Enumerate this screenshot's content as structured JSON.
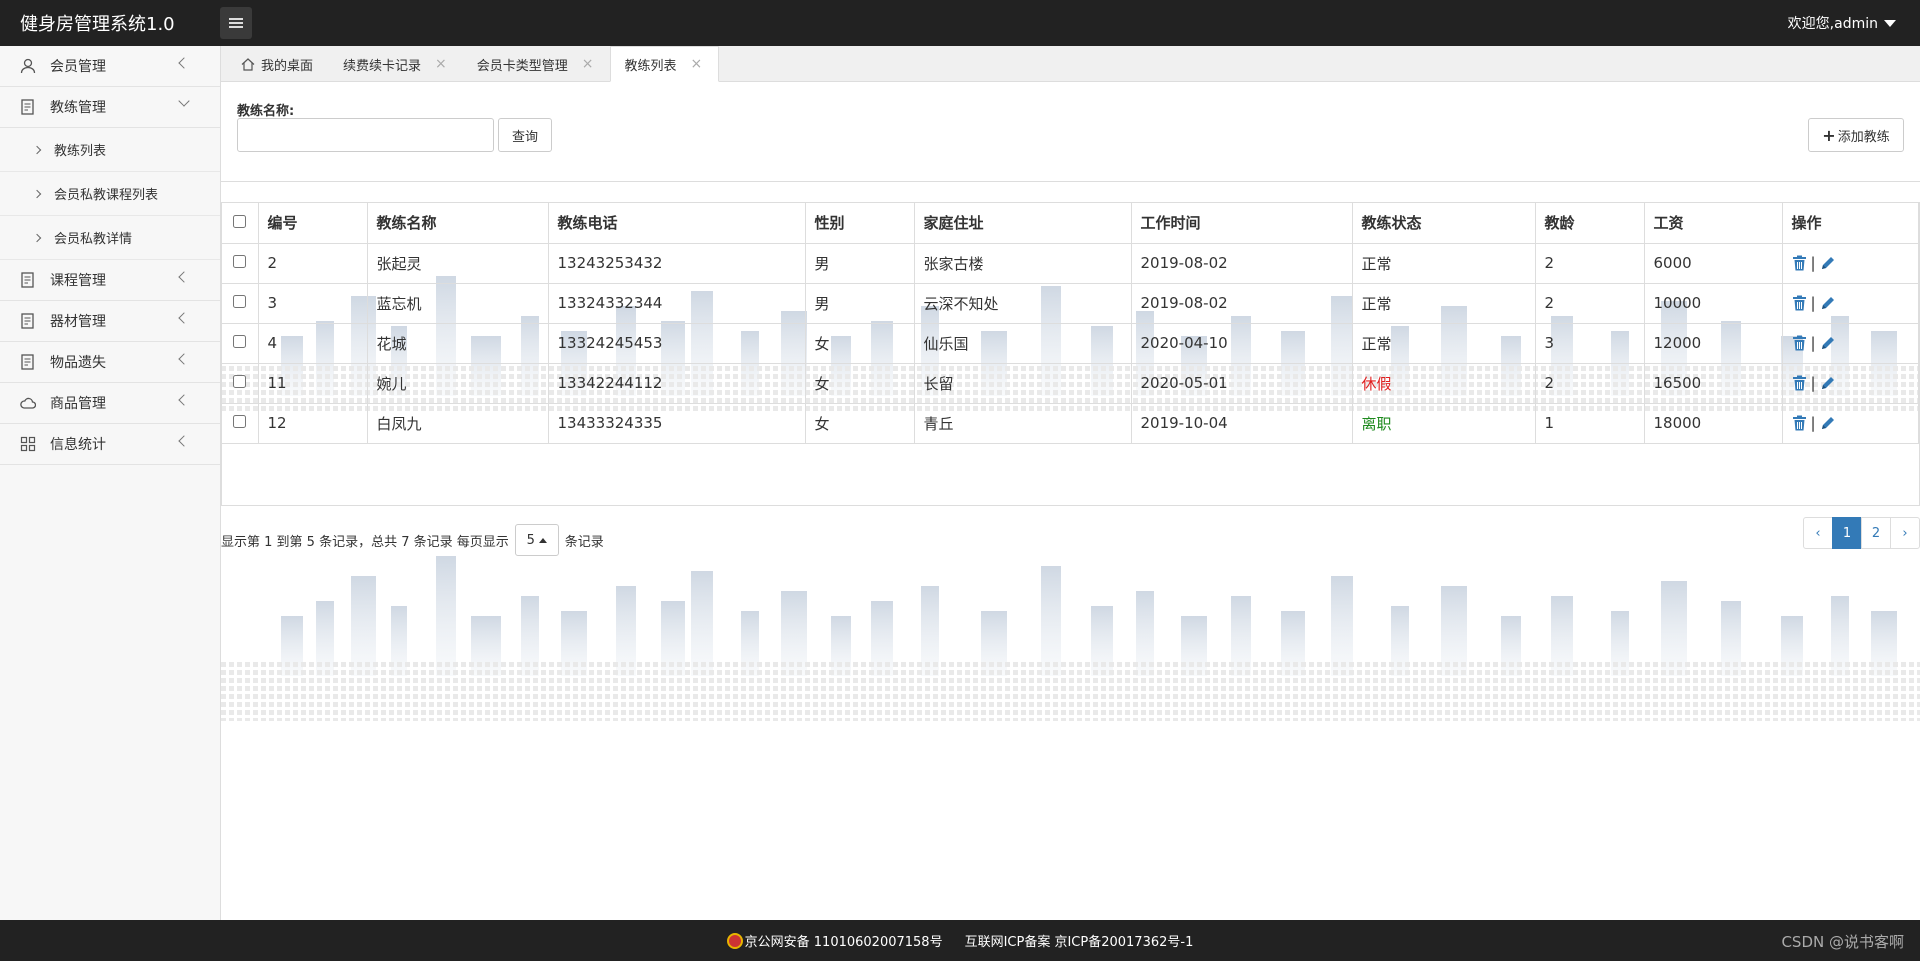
{
  "header": {
    "title": "健身房管理系统1.0",
    "user_greeting": "欢迎您,admin"
  },
  "sidebar": {
    "items": [
      {
        "label": "会员管理",
        "icon": "user-icon"
      },
      {
        "label": "教练管理",
        "icon": "document-icon",
        "expanded": true,
        "children": [
          "教练列表",
          "会员私教课程列表",
          "会员私教详情"
        ]
      },
      {
        "label": "课程管理",
        "icon": "document-icon"
      },
      {
        "label": "器材管理",
        "icon": "document-icon"
      },
      {
        "label": "物品遗失",
        "icon": "document-icon"
      },
      {
        "label": "商品管理",
        "icon": "cloud-icon"
      },
      {
        "label": "信息统计",
        "icon": "grid-icon"
      }
    ]
  },
  "tabs": [
    {
      "label": "我的桌面",
      "closable": false,
      "icon": "home-icon"
    },
    {
      "label": "续费续卡记录",
      "closable": true
    },
    {
      "label": "会员卡类型管理",
      "closable": true
    },
    {
      "label": "教练列表",
      "closable": true,
      "active": true
    }
  ],
  "search": {
    "label": "教练名称:",
    "value": "",
    "query_button": "查询",
    "add_button": "添加教练"
  },
  "table": {
    "headers": [
      "编号",
      "教练名称",
      "教练电话",
      "性别",
      "家庭住址",
      "工作时间",
      "教练状态",
      "教龄",
      "工资",
      "操作"
    ],
    "rows": [
      {
        "id": "2",
        "name": "张起灵",
        "phone": "13243253432",
        "gender": "男",
        "address": "张家古楼",
        "work_date": "2019-08-02",
        "status": "正常",
        "status_color": "#333333",
        "years": "2",
        "salary": "6000"
      },
      {
        "id": "3",
        "name": "蓝忘机",
        "phone": "13324332344",
        "gender": "男",
        "address": "云深不知处",
        "work_date": "2019-08-02",
        "status": "正常",
        "status_color": "#333333",
        "years": "2",
        "salary": "10000"
      },
      {
        "id": "4",
        "name": "花城",
        "phone": "13324245453",
        "gender": "女",
        "address": "仙乐国",
        "work_date": "2020-04-10",
        "status": "正常",
        "status_color": "#333333",
        "years": "3",
        "salary": "12000"
      },
      {
        "id": "11",
        "name": "婉儿",
        "phone": "13342244112",
        "gender": "女",
        "address": "长留",
        "work_date": "2020-05-01",
        "status": "休假",
        "status_color": "#e02020",
        "years": "2",
        "salary": "16500"
      },
      {
        "id": "12",
        "name": "白凤九",
        "phone": "13433324335",
        "gender": "女",
        "address": "青丘",
        "work_date": "2019-10-04",
        "status": "离职",
        "status_color": "#1e8a1e",
        "years": "1",
        "salary": "18000"
      }
    ]
  },
  "pagination": {
    "info_prefix": "显示第 1 到第 5 条记录，总共 7 条记录 每页显示",
    "page_size": "5",
    "info_suffix": "条记录",
    "prev": "‹",
    "pages": [
      "1",
      "2"
    ],
    "current": "1",
    "next": "›"
  },
  "footer": {
    "police_record": "京公网安备 11010602007158号",
    "icp_record": "互联网ICP备案 京ICP备20017362号-1",
    "watermark": "CSDN @说书客啊"
  },
  "colors": {
    "accent": "#337ab7",
    "header_bg": "#222222"
  }
}
